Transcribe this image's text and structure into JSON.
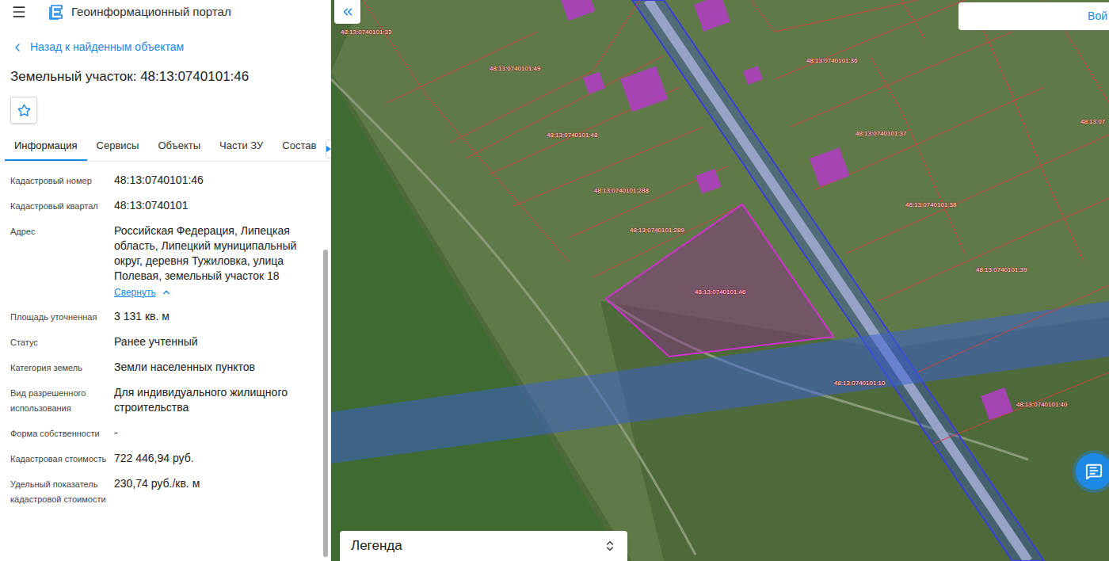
{
  "header": {
    "title": "Геоинформационный портал"
  },
  "back_link": "Назад к найденным объектам",
  "title": "Земельный участок: 48:13:0740101:46",
  "favorite": false,
  "tabs": [
    {
      "label": "Информация",
      "selected": true
    },
    {
      "label": "Сервисы",
      "selected": false
    },
    {
      "label": "Объекты",
      "selected": false
    },
    {
      "label": "Части ЗУ",
      "selected": false
    },
    {
      "label": "Состав",
      "selected": false
    }
  ],
  "fields": [
    {
      "kind": "plain",
      "label": "Кадастровый номер",
      "value": "48:13:0740101:46"
    },
    {
      "kind": "plain",
      "label": "Кадастровый квартал",
      "value": "48:13:0740101"
    },
    {
      "kind": "address",
      "label": "Адрес",
      "value": "Российская Федерация, Липецкая область, Липецкий муниципальный округ, деревня Тужиловка, улица Полевая, земельный участок 18",
      "toggle": "Свернуть",
      "expanded": true
    },
    {
      "kind": "plain",
      "label": "Площадь уточненная",
      "value": "3 131 кв. м"
    },
    {
      "kind": "plain",
      "label": "Статус",
      "value": "Ранее учтенный"
    },
    {
      "kind": "plain",
      "label": "Категория земель",
      "value": "Земли населенных пунктов"
    },
    {
      "kind": "plain",
      "label": "Вид разрешенного использования",
      "value": "Для индивидуального жилищного строительства"
    },
    {
      "kind": "plain",
      "label": "Форма собственности",
      "value": "-"
    },
    {
      "kind": "plain",
      "label": "Кадастровая стоимость",
      "value": "722 446,94 руб."
    },
    {
      "kind": "plain",
      "label": "Удельный показатель кадастровой стоимости",
      "value": "230,74 руб./кв. м"
    }
  ],
  "map": {
    "login_button": "Вой",
    "legend": "Легенда",
    "labels": [
      {
        "text": "48:13:0740101:33",
        "selected": false
      },
      {
        "text": "48:13:0740101:49",
        "selected": false
      },
      {
        "text": "48:13:0740101:48",
        "selected": false
      },
      {
        "text": "48:13:0740101:288",
        "selected": false
      },
      {
        "text": "48:13:0740101:289",
        "selected": false
      },
      {
        "text": "48:13:0740101:46",
        "selected": true
      },
      {
        "text": "48:13:0740101:10",
        "selected": false
      },
      {
        "text": "48:13:0740101:36",
        "selected": false
      },
      {
        "text": "48:13:0740101:37",
        "selected": false
      },
      {
        "text": "48:13:0740101:38",
        "selected": false
      },
      {
        "text": "48:13:0740101:39",
        "selected": false
      },
      {
        "text": "48:13:0740101:40",
        "selected": false
      },
      {
        "text": "48:13:07",
        "selected": false
      }
    ]
  }
}
